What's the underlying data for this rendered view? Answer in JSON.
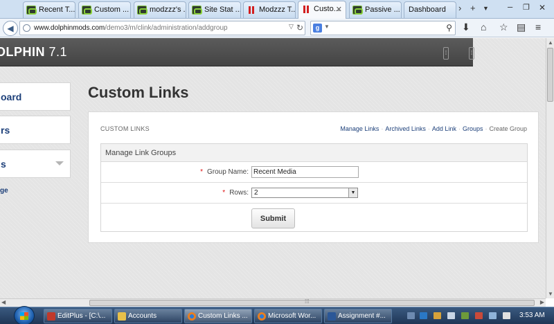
{
  "browser": {
    "tabs": [
      {
        "label": "Recent T...",
        "icon": "tenth-icon"
      },
      {
        "label": "Custom ...",
        "icon": "tenth-icon"
      },
      {
        "label": "modzzz's ...",
        "icon": "tenth-icon"
      },
      {
        "label": "Site Stat ...",
        "icon": "tenth-icon"
      },
      {
        "label": "Modzzz T...",
        "icon": "pause-icon"
      },
      {
        "label": "Custo...",
        "icon": "pause-icon",
        "active": true
      },
      {
        "label": "Passive ...",
        "icon": "tenth-icon"
      },
      {
        "label": "Dashboard",
        "icon": ""
      }
    ],
    "url_host": "www.dolphinmods.com",
    "url_path": "/demo3/m/clink/administration/addgroup",
    "search_engine": "g"
  },
  "site": {
    "brand_prefix": "OLPHIN",
    "brand_version": "7.1",
    "sidebar": [
      {
        "label": "oard"
      },
      {
        "label": "rs"
      },
      {
        "label": "s"
      }
    ],
    "sidebar_link": "ge"
  },
  "main": {
    "title": "Custom Links",
    "panel_title": "CUSTOM LINKS",
    "breadcrumbs": [
      "Manage Links",
      "Archived Links",
      "Add Link",
      "Groups"
    ],
    "breadcrumb_current": "Create Group",
    "separator": "·",
    "form": {
      "heading": "Manage Link Groups",
      "required_mark": "*",
      "group_name_label": "Group Name:",
      "group_name_value": "Recent Media",
      "rows_label": "Rows:",
      "rows_value": "2",
      "submit_label": "Submit"
    }
  },
  "taskbar": {
    "items": [
      {
        "label": "EditPlus - [C:\\...",
        "icon": "editplus-icon"
      },
      {
        "label": "Accounts",
        "icon": "folder-icon"
      },
      {
        "label": "Custom Links ...",
        "icon": "firefox-icon",
        "active": true
      },
      {
        "label": "Microsoft Wor...",
        "icon": "firefox-icon"
      },
      {
        "label": "Assignment #...",
        "icon": "word-icon"
      }
    ],
    "clock": "3:53 AM"
  },
  "colors": {
    "accent": "#1c3f79",
    "required": "#dd1111",
    "topbar": "#4d4d4d"
  }
}
